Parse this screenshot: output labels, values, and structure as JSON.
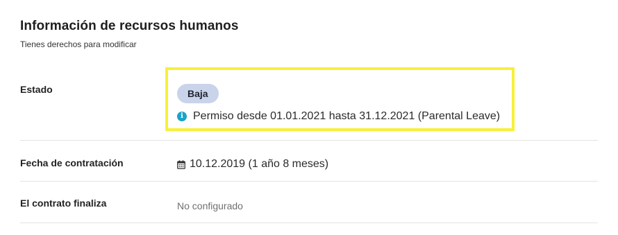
{
  "section": {
    "title": "Información de recursos humanos",
    "subtitle": "Tienes derechos para modificar"
  },
  "rows": {
    "status": {
      "label": "Estado",
      "badge": "Baja",
      "info_icon": "info-circle-icon",
      "leave_text": "Permiso desde 01.01.2021 hasta 31.12.2021 (Parental Leave)"
    },
    "hire_date": {
      "label": "Fecha de contratación",
      "icon": "calendar-icon",
      "value": "10.12.2019 (1 año 8 meses)"
    },
    "contract_end": {
      "label": "El contrato finaliza",
      "value": "No configurado"
    }
  },
  "colors": {
    "highlight_border": "#f7f03a",
    "badge_background": "#c9d3ea",
    "info_icon": "#1aa3c9",
    "divider": "#e3e3e3"
  }
}
